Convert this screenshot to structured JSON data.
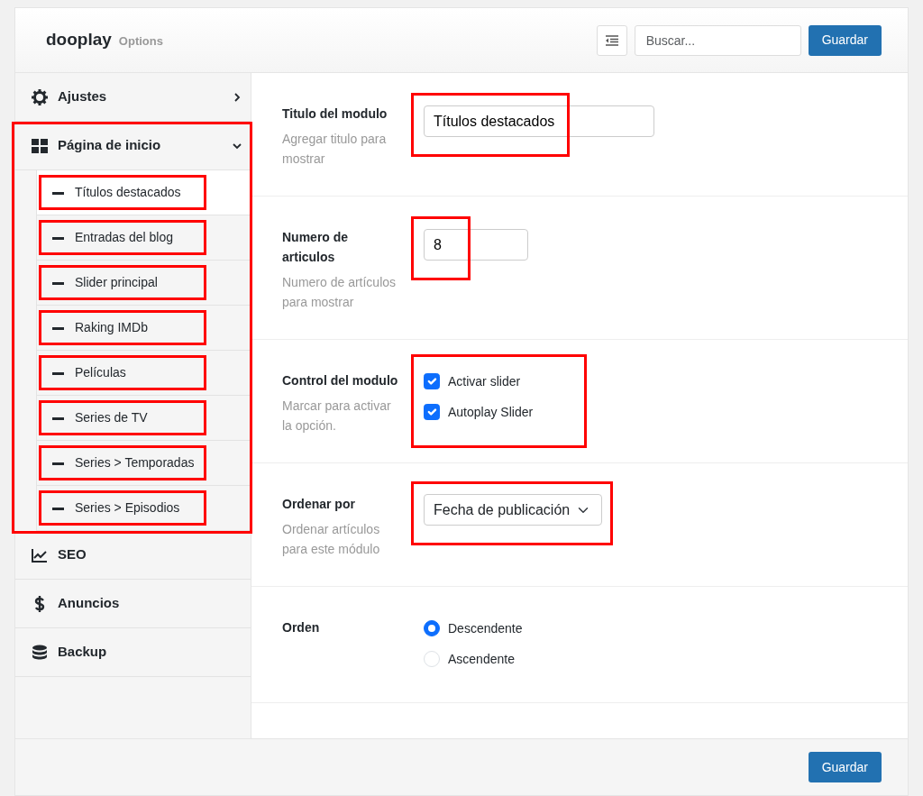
{
  "header": {
    "brand": "dooplay",
    "subtitle": "Options",
    "search": {
      "placeholder": "Buscar..."
    },
    "save_button": "Guardar"
  },
  "sidebar": {
    "items": [
      {
        "label": "Ajustes",
        "kind": "gear",
        "expanded": false
      },
      {
        "label": "Página de inicio",
        "kind": "grid",
        "expanded": true,
        "highlighted": true,
        "children": [
          {
            "label": "Títulos destacados",
            "selected": true,
            "highlighted": true
          },
          {
            "label": "Entradas del blog",
            "selected": false,
            "highlighted": true
          },
          {
            "label": "Slider principal",
            "selected": false,
            "highlighted": true
          },
          {
            "label": "Raking IMDb",
            "selected": false,
            "highlighted": true
          },
          {
            "label": "Películas",
            "selected": false,
            "highlighted": true
          },
          {
            "label": "Series de TV",
            "selected": false,
            "highlighted": true
          },
          {
            "label": "Series > Temporadas",
            "selected": false,
            "highlighted": true
          },
          {
            "label": "Series > Episodios",
            "selected": false,
            "highlighted": true
          }
        ]
      },
      {
        "label": "SEO",
        "kind": "chart"
      },
      {
        "label": "Anuncios",
        "kind": "dollar"
      },
      {
        "label": "Backup",
        "kind": "database"
      }
    ]
  },
  "fields": [
    {
      "kind": "text",
      "title": "Titulo del modulo",
      "description": "Agregar titulo para mostrar",
      "value": "Títulos destacados",
      "highlighted": true
    },
    {
      "kind": "number",
      "title": "Numero de articulos",
      "description": "Numero de artículos para mostrar",
      "value": "8",
      "highlighted": true
    },
    {
      "kind": "checkboxes",
      "title": "Control del modulo",
      "description": "Marcar para activar la opción.",
      "highlighted": true,
      "options": [
        {
          "label": "Activar slider",
          "checked": true
        },
        {
          "label": "Autoplay Slider",
          "checked": true
        }
      ]
    },
    {
      "kind": "select",
      "title": "Ordenar por",
      "description": "Ordenar artículos para este módulo",
      "value": "Fecha de publicación",
      "highlighted": true
    },
    {
      "kind": "radio",
      "title": "Orden",
      "options": [
        {
          "label": "Descendente",
          "selected": true
        },
        {
          "label": "Ascendente",
          "selected": false
        }
      ]
    }
  ],
  "footer": {
    "save_button": "Guardar"
  }
}
